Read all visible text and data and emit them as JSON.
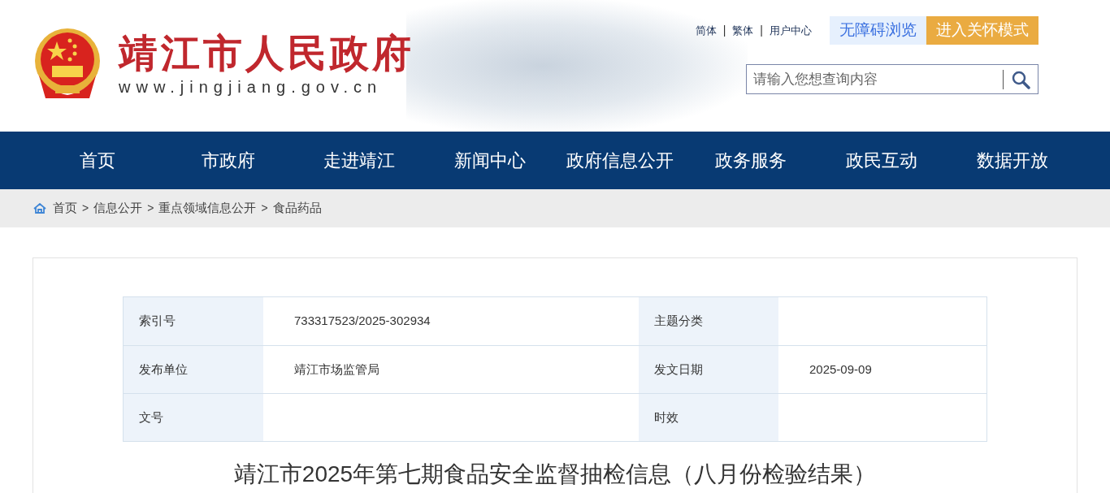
{
  "header": {
    "site_name": "靖江市人民政府",
    "site_url": "www.jingjiang.gov.cn",
    "top_links": [
      "简体",
      "繁体",
      "用户中心"
    ],
    "link_separator": "|",
    "accessibility_button": "无障碍浏览",
    "care_mode_button": "进入关怀模式",
    "search": {
      "placeholder": "请输入您想查询内容"
    }
  },
  "nav": {
    "items": [
      {
        "label": "首页",
        "selected": false
      },
      {
        "label": "市政府",
        "selected": false
      },
      {
        "label": "走进靖江",
        "selected": false
      },
      {
        "label": "新闻中心",
        "selected": false
      },
      {
        "label": "政府信息公开",
        "selected": false
      },
      {
        "label": "政务服务",
        "selected": false
      },
      {
        "label": "政民互动",
        "selected": false
      },
      {
        "label": "数据开放",
        "selected": false
      }
    ]
  },
  "breadcrumb": [
    {
      "kind": "link",
      "text": "首页"
    },
    {
      "kind": "separator",
      "text": ">"
    },
    {
      "kind": "link",
      "text": "信息公开"
    },
    {
      "kind": "separator",
      "text": ">"
    },
    {
      "kind": "link",
      "text": "重点领域信息公开"
    },
    {
      "kind": "separator",
      "text": ">"
    },
    {
      "kind": "link",
      "text": "食品药品"
    }
  ],
  "info_table": {
    "rows": [
      [
        {
          "label": "索引号",
          "value": "733317523/2025-302934"
        },
        {
          "label": "主题分类"
        }
      ],
      [
        {
          "label": "发布单位",
          "value": "靖江市场监管局"
        },
        {
          "label": "发文日期",
          "value": "2025-09-09"
        }
      ],
      [
        {
          "label": "文号"
        },
        {
          "label": "时效"
        }
      ]
    ]
  },
  "article": {
    "title": "靖江市2025年第七期食品安全监督抽检信息（八月份检验结果）"
  }
}
